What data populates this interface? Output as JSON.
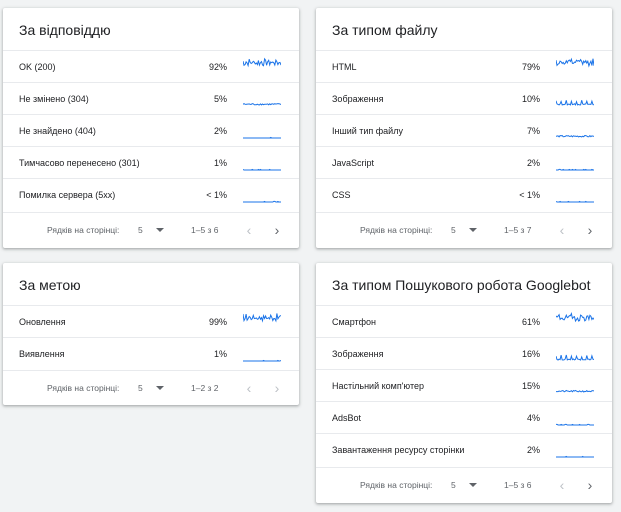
{
  "cards": [
    {
      "title": "За відповіддю",
      "rows": [
        {
          "label": "OK (200)",
          "pct": "92%",
          "spark": "dense"
        },
        {
          "label": "Не змінено (304)",
          "pct": "5%",
          "spark": "low"
        },
        {
          "label": "Не знайдено (404)",
          "pct": "2%",
          "spark": "flat"
        },
        {
          "label": "Тимчасово перенесено (301)",
          "pct": "1%",
          "spark": "flat"
        },
        {
          "label": "Помилка сервера (5xx)",
          "pct": "< 1%",
          "spark": "flat"
        }
      ],
      "pager": {
        "rows_label": "Рядків на сторінці:",
        "rows_value": "5",
        "range": "1–5 з 6"
      }
    },
    {
      "title": "За типом файлу",
      "rows": [
        {
          "label": "HTML",
          "pct": "79%",
          "spark": "dense"
        },
        {
          "label": "Зображення",
          "pct": "10%",
          "spark": "spiky"
        },
        {
          "label": "Інший тип файлу",
          "pct": "7%",
          "spark": "low"
        },
        {
          "label": "JavaScript",
          "pct": "2%",
          "spark": "flat"
        },
        {
          "label": "CSS",
          "pct": "< 1%",
          "spark": "flat"
        }
      ],
      "pager": {
        "rows_label": "Рядків на сторінці:",
        "rows_value": "5",
        "range": "1–5 з 7"
      }
    },
    {
      "title": "За метою",
      "rows": [
        {
          "label": "Оновлення",
          "pct": "99%",
          "spark": "dense"
        },
        {
          "label": "Виявлення",
          "pct": "1%",
          "spark": "flat"
        }
      ],
      "pager": {
        "rows_label": "Рядків на сторінці:",
        "rows_value": "5",
        "range": "1–2 з 2"
      }
    },
    {
      "title": "За типом Пошукового робота Googlebot",
      "rows": [
        {
          "label": "Смартфон",
          "pct": "61%",
          "spark": "dense"
        },
        {
          "label": "Зображення",
          "pct": "16%",
          "spark": "spiky"
        },
        {
          "label": "Настільний комп'ютер",
          "pct": "15%",
          "spark": "low"
        },
        {
          "label": "AdsBot",
          "pct": "4%",
          "spark": "flat"
        },
        {
          "label": "Завантаження ресурсу сторінки",
          "pct": "2%",
          "spark": "flat"
        }
      ],
      "pager": {
        "rows_label": "Рядків на сторінці:",
        "rows_value": "5",
        "range": "1–5 з 6"
      }
    }
  ],
  "icons": {
    "prev": "chevron-left-icon",
    "next": "chevron-right-icon",
    "dropdown": "triangle-down-icon"
  },
  "colors": {
    "accent": "#1a73e8",
    "background": "#f1f3f4",
    "card": "#ffffff"
  }
}
